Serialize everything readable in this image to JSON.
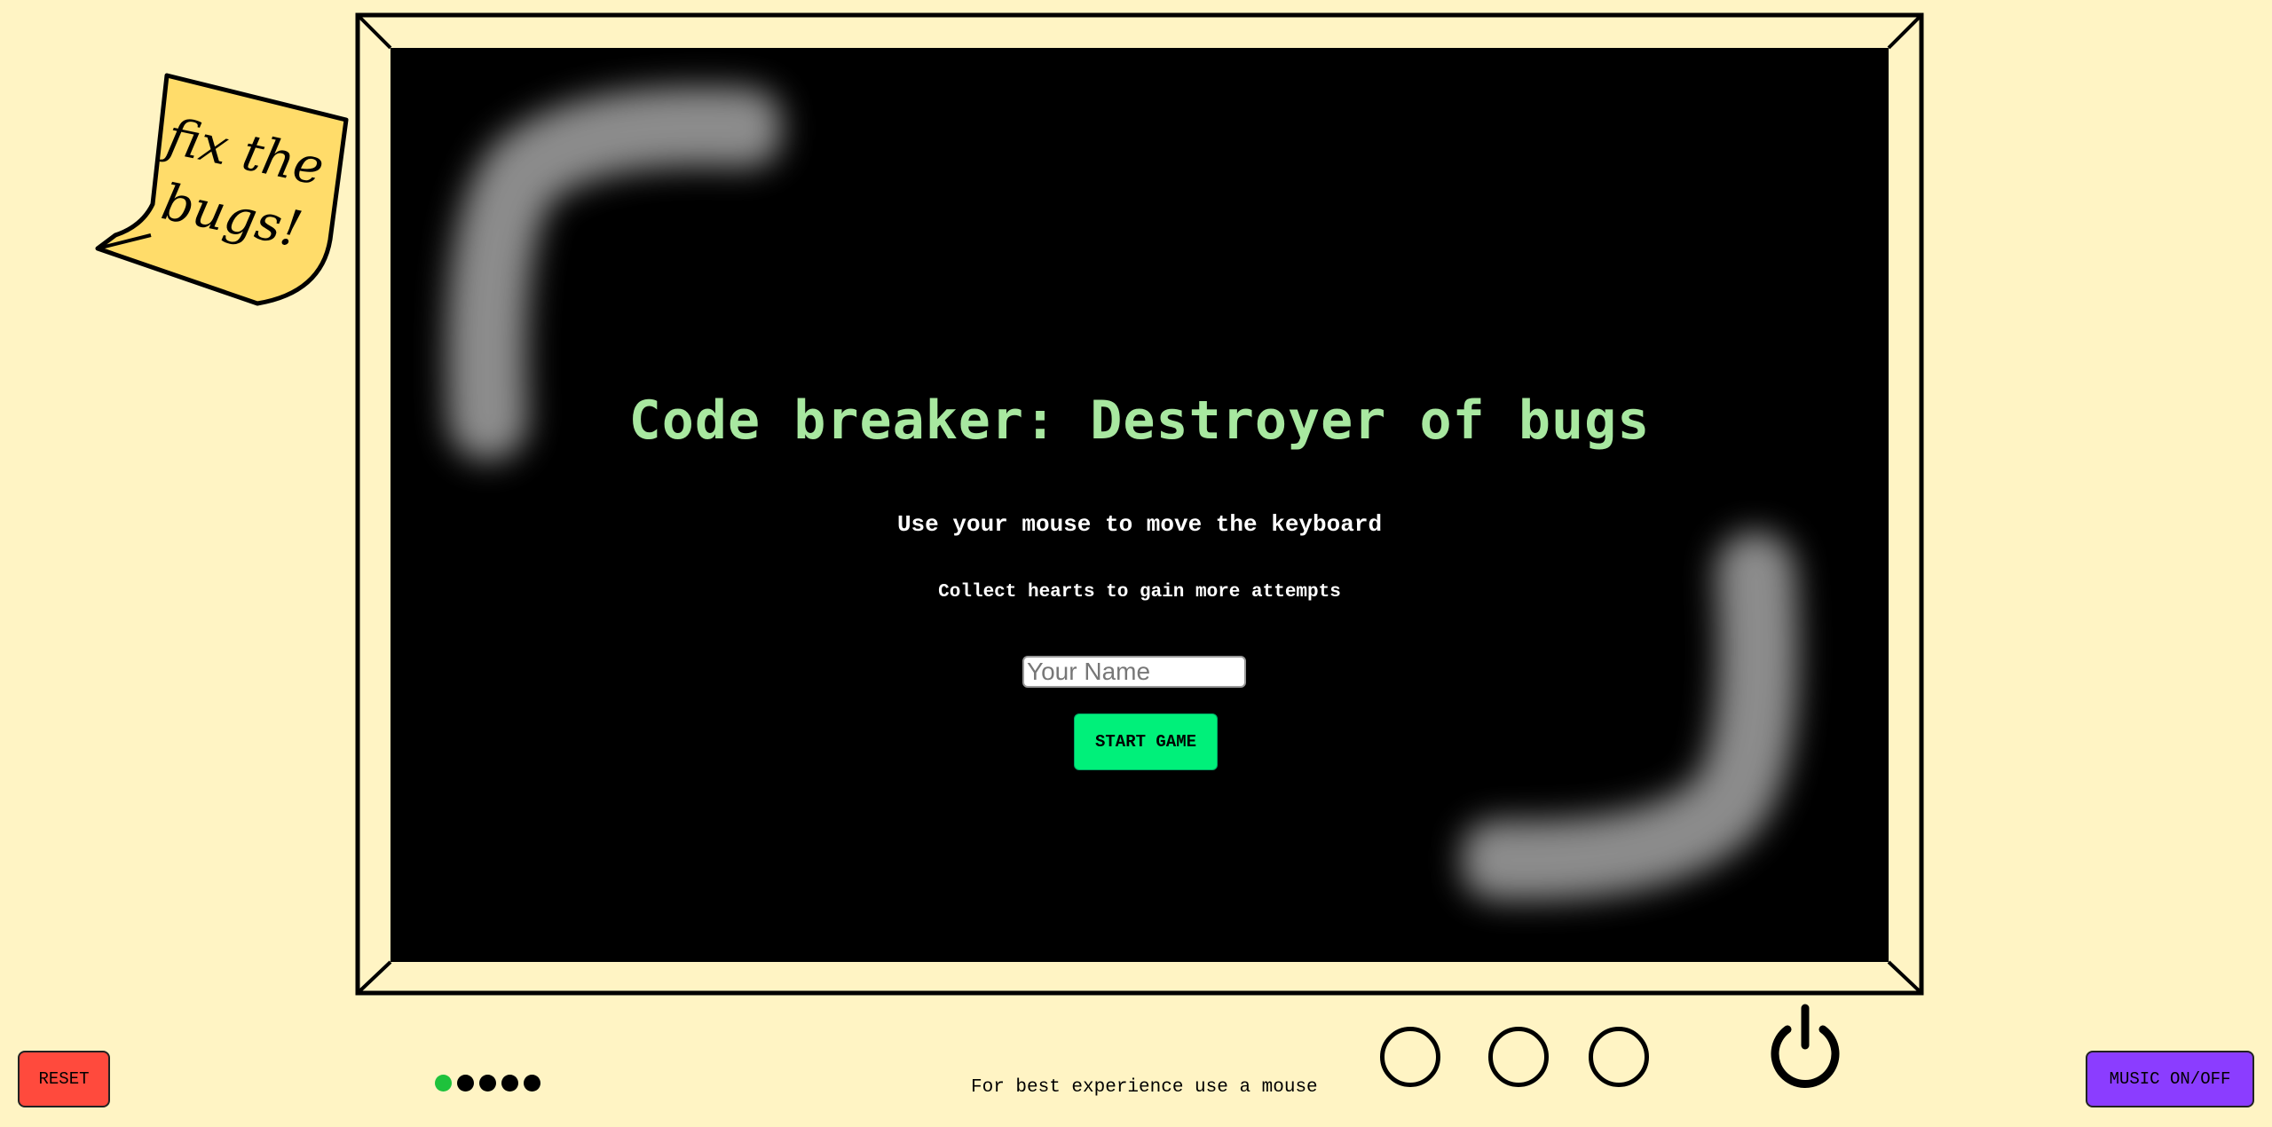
{
  "sticky_note": {
    "line1": "fix the",
    "line2": "bugs!",
    "color": "#ffdc6a"
  },
  "screen": {
    "title": "Code breaker: Destroyer of bugs",
    "instruction_1": "Use your mouse to move the keyboard",
    "instruction_2": "Collect hearts to gain more attempts",
    "name_input": {
      "placeholder": "Your Name",
      "value": ""
    },
    "start_button_label": "START GAME",
    "title_color": "#a8e8a0",
    "start_button_color": "#00f07a"
  },
  "controls": {
    "reset_label": "RESET",
    "music_label": "MUSIC ON/OFF",
    "hint": "For best experience use a mouse",
    "level_dots": {
      "total": 5,
      "active_index": 0
    },
    "knob_icons": [
      "knob-icon",
      "knob-icon",
      "knob-icon"
    ],
    "power_icon": "power-icon",
    "reset_color": "#ff4a3d",
    "music_color": "#8b3dff"
  },
  "colors": {
    "background": "#fff4c4",
    "screen": "#000000"
  }
}
